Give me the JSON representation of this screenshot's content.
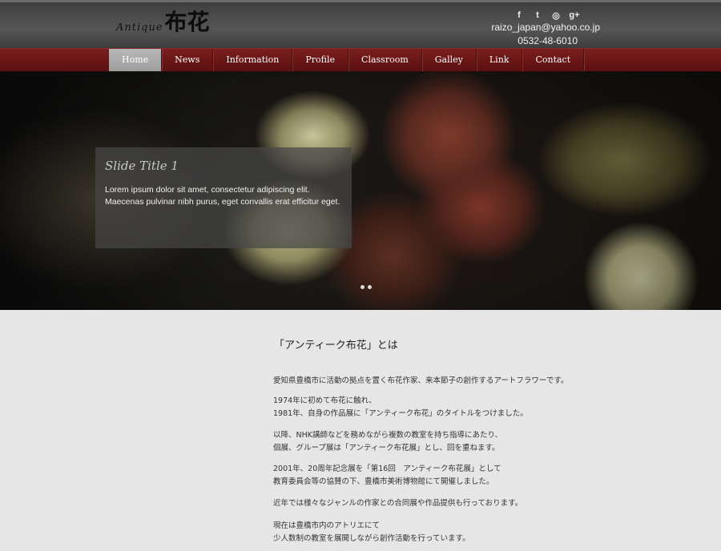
{
  "header": {
    "logo_script": "Antique",
    "logo_kanji": "布花",
    "social": [
      "f",
      "t",
      "◎",
      "g+"
    ],
    "email": "raizo_japan@yahoo.co.jp",
    "phone": "0532-48-6010"
  },
  "nav": {
    "items": [
      "Home",
      "News",
      "Information",
      "Profile",
      "Classroom",
      "Galley",
      "Link",
      "Contact"
    ],
    "active": "Home"
  },
  "slider": {
    "title": "Slide Title 1",
    "text": "Lorem ipsum dolor sit amet, consectetur adipiscing elit. Maecenas pulvinar nibh purus, eget convallis erat efficitur eget.",
    "slide_count": 2
  },
  "content": {
    "heading": "「アンティーク布花」とは",
    "paragraphs": [
      [
        "愛知県豊橋市に活動の拠点を置く布花作家、来本節子の創作するアートフラワーです。"
      ],
      [
        "1974年に初めて布花に触れ、",
        "1981年、自身の作品展に「アンティーク布花」のタイトルをつけました。"
      ],
      [
        "以降、NHK講師などを務めながら複数の教室を持ち指導にあたり、",
        "個展、グループ展は「アンティーク布花展」とし、回を重ねます。"
      ],
      [
        "2001年、20周年記念展を「第16回　アンティーク布花展」として",
        "教育委員会等の協賛の下、豊橋市美術博物館にて開催しました。"
      ],
      [
        "近年では様々なジャンルの作家との合同展や作品提供も行っております。"
      ],
      [
        "現在は豊橋市内のアトリエにて",
        "少人数制の教室を展開しながら創作活動を行っています。"
      ]
    ]
  }
}
